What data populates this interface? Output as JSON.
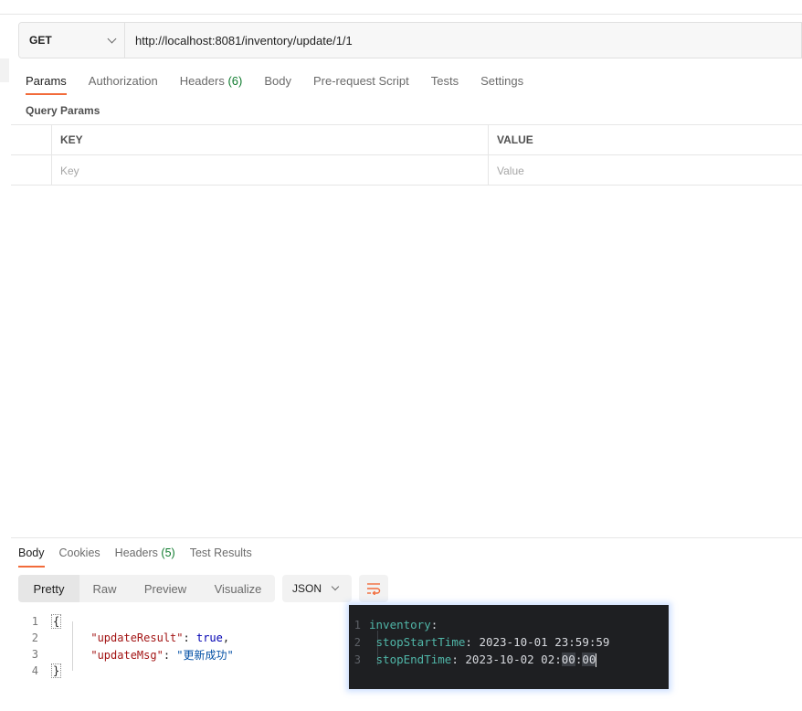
{
  "request": {
    "method": "GET",
    "url": "http://localhost:8081/inventory/update/1/1"
  },
  "request_tabs": [
    {
      "label": "Params",
      "count": ""
    },
    {
      "label": "Authorization",
      "count": ""
    },
    {
      "label": "Headers",
      "count": "(6)"
    },
    {
      "label": "Body",
      "count": ""
    },
    {
      "label": "Pre-request Script",
      "count": ""
    },
    {
      "label": "Tests",
      "count": ""
    },
    {
      "label": "Settings",
      "count": ""
    }
  ],
  "query_params": {
    "title": "Query Params",
    "key_header": "KEY",
    "value_header": "VALUE",
    "key_placeholder": "Key",
    "value_placeholder": "Value"
  },
  "response_tabs": [
    {
      "label": "Body",
      "count": ""
    },
    {
      "label": "Cookies",
      "count": ""
    },
    {
      "label": "Headers",
      "count": "(5)"
    },
    {
      "label": "Test Results",
      "count": ""
    }
  ],
  "view_modes": [
    "Pretty",
    "Raw",
    "Preview",
    "Visualize"
  ],
  "format": "JSON",
  "response_body": {
    "line_numbers": [
      "1",
      "2",
      "3",
      "4"
    ],
    "open_brace": "{",
    "close_brace": "}",
    "entries": [
      {
        "key": "\"updateResult\"",
        "value": "true",
        "suffix": ","
      },
      {
        "key": "\"updateMsg\"",
        "value": "\"更新成功\"",
        "suffix": ""
      }
    ]
  },
  "yaml_overlay": {
    "line_numbers": [
      "1",
      "2",
      "3"
    ],
    "root_key": "inventory",
    "stop_start_key": "stopStartTime",
    "stop_start_value": "2023-10-01 23:59:59",
    "stop_end_key": "stopEndTime",
    "stop_end_prefix": "2023-10-02 02:",
    "stop_end_minutes": "00",
    "stop_end_sep": ":",
    "stop_end_seconds": "00"
  },
  "colors": {
    "accent": "#f26b3a",
    "count_green": "#0f7b2e",
    "json_key": "#a31515",
    "json_bool": "#0000b3",
    "json_string": "#0451a5",
    "yaml_bg": "#1e1f22",
    "yaml_key": "#50b6a8"
  },
  "icons": {
    "method_dropdown": "chevron-down-icon",
    "format_dropdown": "chevron-down-icon",
    "wrap": "wrap-lines-icon"
  }
}
